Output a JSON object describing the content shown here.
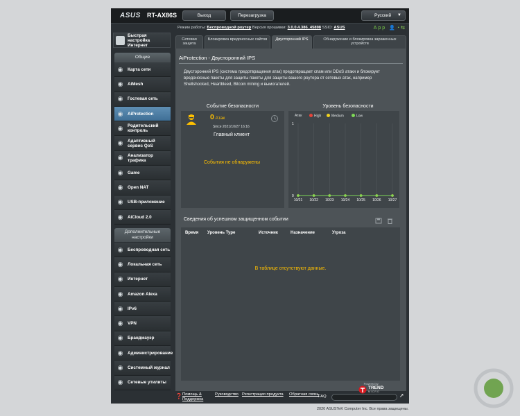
{
  "header": {
    "logo": "ASUS",
    "model": "RT-AX86S",
    "logout_label": "Выход",
    "reboot_label": "Перезагрузка",
    "language": "Русский"
  },
  "status_bar": {
    "mode_label": "Режим работы:",
    "mode_value": "Беспроводной роутер",
    "firmware_label": "Версия прошивки:",
    "firmware_value": "3.0.0.4.386_45898",
    "ssid_label": "SSID:",
    "ssid_value": "ASUS",
    "app_label": "App"
  },
  "sidebar": {
    "quick_setup": "Быстрая настройка Интернет",
    "general_header": "Общие",
    "general_items": [
      {
        "label": "Карта сети",
        "icon": "network-map-icon"
      },
      {
        "label": "AiMesh",
        "icon": "aimesh-icon"
      },
      {
        "label": "Гостевая сеть",
        "icon": "guest-network-icon"
      },
      {
        "label": "AiProtection",
        "icon": "shield-icon"
      },
      {
        "label": "Родительский контроль",
        "icon": "parental-control-icon"
      },
      {
        "label": "Адаптивный сервис QoS",
        "icon": "qos-icon"
      },
      {
        "label": "Анализатор трафика",
        "icon": "traffic-analyzer-icon"
      },
      {
        "label": "Game",
        "icon": "gamepad-icon"
      },
      {
        "label": "Open NAT",
        "icon": "open-nat-icon"
      },
      {
        "label": "USB-приложение",
        "icon": "usb-icon"
      },
      {
        "label": "AiCloud 2.0",
        "icon": "cloud-icon"
      }
    ],
    "advanced_header": "Дополнительные настройки",
    "advanced_items": [
      {
        "label": "Беспроводная сеть",
        "icon": "wireless-icon"
      },
      {
        "label": "Локальная сеть",
        "icon": "lan-icon"
      },
      {
        "label": "Интернет",
        "icon": "globe-icon"
      },
      {
        "label": "Amazon Alexa",
        "icon": "alexa-icon"
      },
      {
        "label": "IPv6",
        "icon": "ipv6-icon"
      },
      {
        "label": "VPN",
        "icon": "vpn-icon"
      },
      {
        "label": "Брандмауэр",
        "icon": "firewall-icon"
      },
      {
        "label": "Администрирование",
        "icon": "admin-icon"
      },
      {
        "label": "Системный журнал",
        "icon": "system-log-icon"
      },
      {
        "label": "Сетевые утилиты",
        "icon": "network-tools-icon"
      }
    ]
  },
  "tabs": [
    {
      "label": "Сетевая защита"
    },
    {
      "label": "Блокировка вредоносных сайтов"
    },
    {
      "label": "Двусторонний IPS"
    },
    {
      "label": "Обнаружение и блокировка зараженных устройств"
    }
  ],
  "main": {
    "title": "AiProtection - Двусторонний IPS",
    "description": "Двусторонний IPS (система предотвращения атак) предотвращает спам или DDoS атаки и блокирует вредоносные пакеты для защиты пакеты для защиты вашего роутера от сетевых атак, например Shellshocked, Heartbleed, Bitcoin mining и вымогателей.",
    "security_event": {
      "title": "Событие безопасности",
      "attack_count": "0",
      "attack_label": "Атак",
      "since": "Since 2021/10/27 16:16",
      "main_client": "Главный клиент",
      "no_events": "События не обнаружены"
    },
    "security_level": {
      "title": "Уровень безопасности"
    },
    "success_events": {
      "title": "Сведения об успешном защищенном событии",
      "columns": [
        "Время",
        "Уровень Type",
        "Источник",
        "Назначение",
        "Угроза"
      ],
      "no_data": "В таблице отсутствуют данные."
    },
    "powered_by": "Powered by",
    "trend_brand": "TREND",
    "trend_sub": "MICRO"
  },
  "chart_data": {
    "type": "line",
    "title": "Уровень безопасности",
    "ylabel": "Атак",
    "categories": [
      "10/21",
      "10/22",
      "10/23",
      "10/24",
      "10/25",
      "10/26",
      "10/27"
    ],
    "ylim": [
      0,
      1
    ],
    "yticks": [
      "0",
      "1"
    ],
    "legend_position": "top",
    "series": [
      {
        "name": "High",
        "color": "#e8443a",
        "values": [
          0,
          0,
          0,
          0,
          0,
          0,
          0
        ]
      },
      {
        "name": "Medium",
        "color": "#f2d21f",
        "values": [
          0,
          0,
          0,
          0,
          0,
          0,
          0
        ]
      },
      {
        "name": "Low",
        "color": "#7ed957",
        "values": [
          0,
          0,
          0,
          0,
          0,
          0,
          0
        ]
      }
    ],
    "grid": true
  },
  "footer": {
    "help": "Помощь & Поддержка",
    "links": [
      "Руководство",
      "Регистрация продукта",
      "Обратная связь"
    ],
    "faq": "FAQ",
    "copyright": "2020 ASUSTeK Computer Inc. Все права защищены."
  },
  "colors": {
    "accent_orange": "#ffc000",
    "active_menu": "#4f80a8",
    "panel": "#4d5357"
  }
}
